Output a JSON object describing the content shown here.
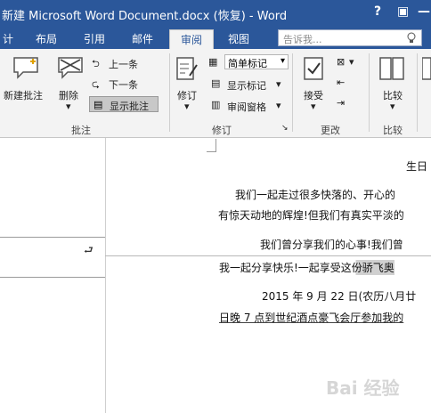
{
  "window": {
    "title": "新建 Microsoft Word Document.docx (恢复) - Word",
    "help": "?",
    "restore": "▣",
    "minimize": "—"
  },
  "tabs": [
    {
      "label": "计",
      "active": false
    },
    {
      "label": "布局",
      "active": false
    },
    {
      "label": "引用",
      "active": false
    },
    {
      "label": "邮件",
      "active": false
    },
    {
      "label": "审阅",
      "active": true
    },
    {
      "label": "视图",
      "active": false
    }
  ],
  "search": {
    "placeholder": "告诉我..."
  },
  "ribbon": {
    "new_comment": "新建批注",
    "delete": "删除",
    "prev": "上一条",
    "next": "下一条",
    "show_comments": "显示批注",
    "group_comments": "批注",
    "track": "修订",
    "simple_markup": "简单标记",
    "show_markup": "显示标记",
    "review_pane": "审阅窗格",
    "group_tracking": "修订",
    "accept": "接受",
    "group_changes": "更改",
    "compare": "比较",
    "group_compare": "比较"
  },
  "document": {
    "lines": [
      "生日",
      "我们一起走过很多快落的、开心的",
      "有惊天动地的辉煌!但我们有真实平淡的",
      "我们曾分享我们的心事!我们曾",
      "我一起分享快乐!一起享受这份骄飞奥",
      "2015 年 9 月 22 日(农历八月廿",
      "日晚 7 点到世纪酒点豪飞会厅参加我的"
    ]
  },
  "watermark": "Bai 经验"
}
